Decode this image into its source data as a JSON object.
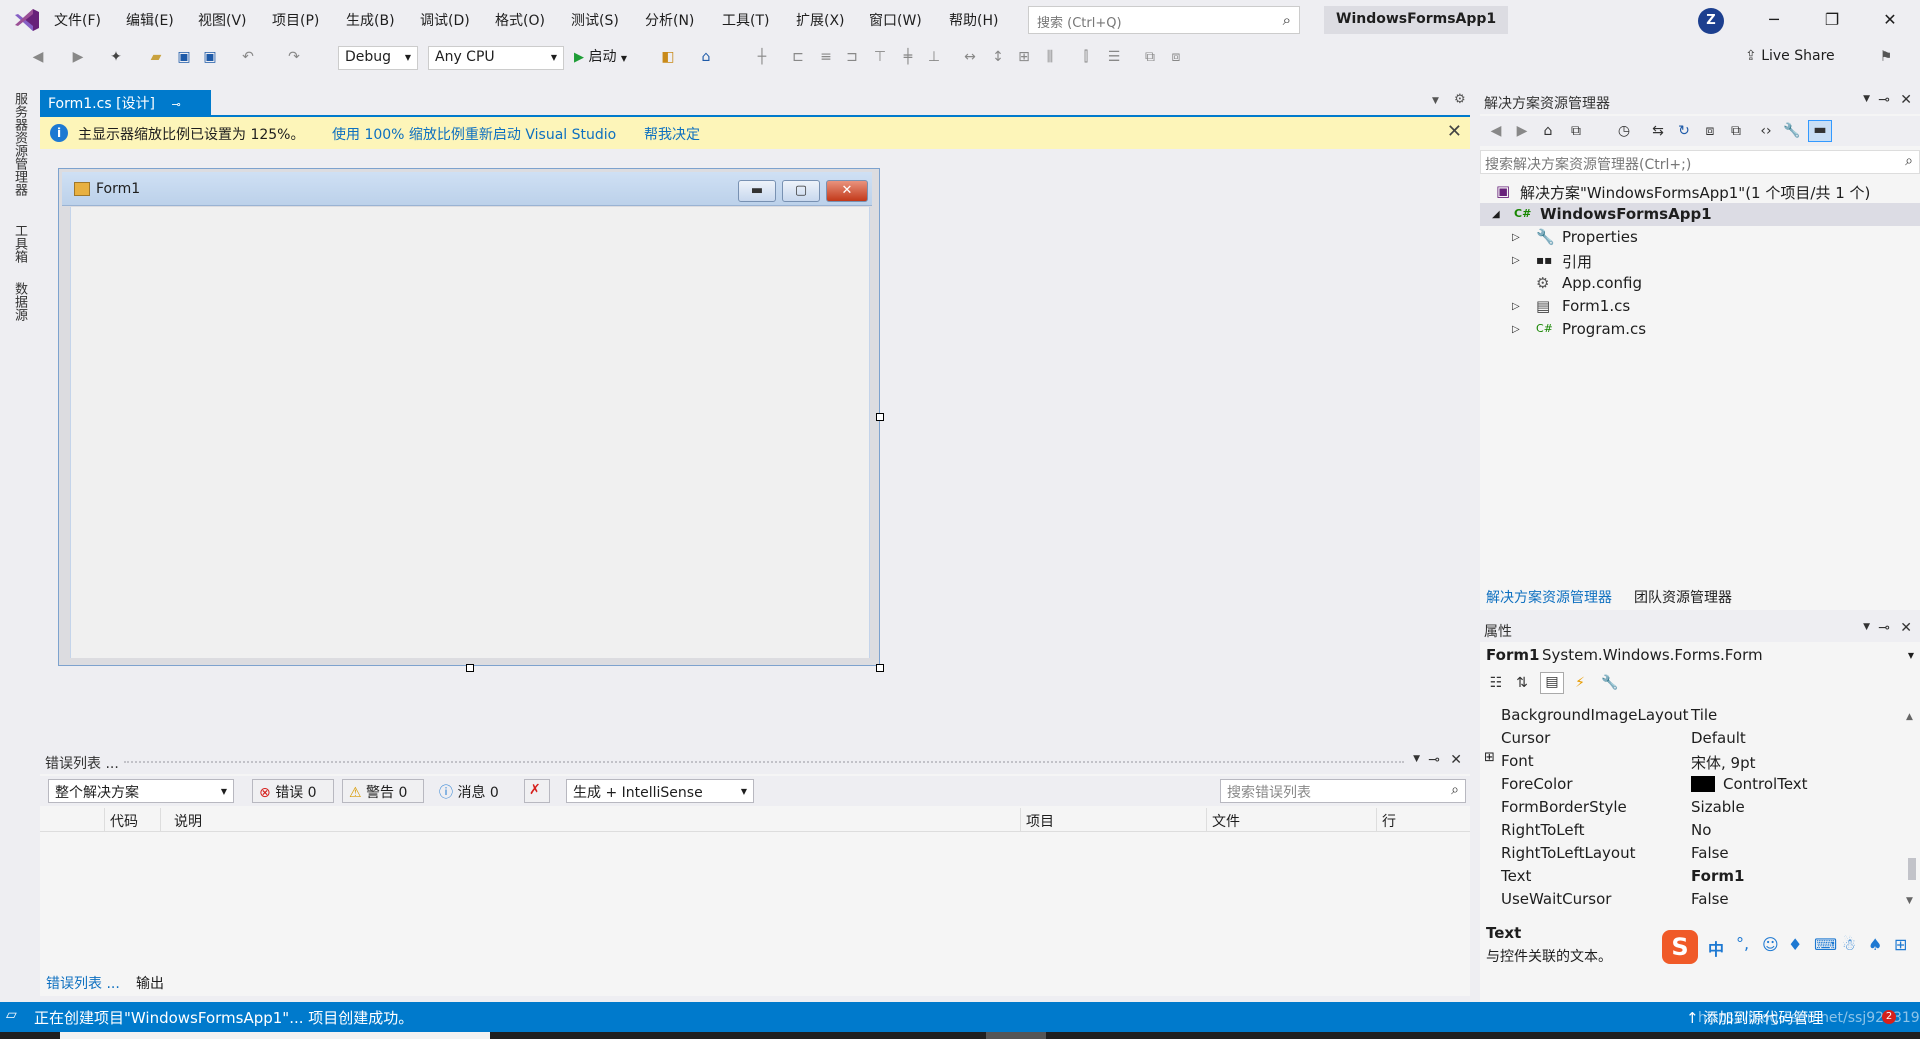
{
  "menu": {
    "items": [
      "文件(F)",
      "编辑(E)",
      "视图(V)",
      "项目(P)",
      "生成(B)",
      "调试(D)",
      "格式(O)",
      "测试(S)",
      "分析(N)",
      "工具(T)",
      "扩展(X)",
      "窗口(W)",
      "帮助(H)"
    ],
    "search_placeholder": "搜索 (Ctrl+Q)",
    "solution_title": "WindowsFormsApp1",
    "avatar": "Z"
  },
  "toolbar": {
    "config": "Debug",
    "platform": "Any CPU",
    "start_label": "启动",
    "live_share": "Live Share"
  },
  "sidebar": {
    "tabs": [
      "服务器资源管理器",
      "工具箱",
      "数据源"
    ]
  },
  "document": {
    "tab_label": "Form1.cs [设计]",
    "info_message": "主显示器缩放比例已设置为 125%。",
    "info_link_restart": "使用 100% 缩放比例重新启动 Visual Studio",
    "info_link_help": "帮我决定",
    "form_title": "Form1"
  },
  "error_list": {
    "title": "错误列表 ...",
    "scope": "整个解决方案",
    "errors": "错误 0",
    "warnings": "警告 0",
    "messages": "消息 0",
    "build_filter": "生成 + IntelliSense",
    "search_placeholder": "搜索错误列表",
    "columns": [
      "代码",
      "说明",
      "项目",
      "文件",
      "行"
    ],
    "bottom_tabs": [
      "错误列表 ...",
      "输出"
    ]
  },
  "solution_explorer": {
    "title": "解决方案资源管理器",
    "search_placeholder": "搜索解决方案资源管理器(Ctrl+;)",
    "items": [
      {
        "label": "解决方案\"WindowsFormsApp1\"(1 个项目/共 1 个)"
      },
      {
        "label": "WindowsFormsApp1"
      },
      {
        "label": "Properties"
      },
      {
        "label": "引用"
      },
      {
        "label": "App.config"
      },
      {
        "label": "Form1.cs"
      },
      {
        "label": "Program.cs"
      }
    ],
    "tabs": [
      "解决方案资源管理器",
      "团队资源管理器"
    ]
  },
  "properties": {
    "title": "属性",
    "object_name": "Form1",
    "object_type": "System.Windows.Forms.Form",
    "rows": [
      {
        "name": "BackgroundImageLayout",
        "value": "Tile"
      },
      {
        "name": "Cursor",
        "value": "Default"
      },
      {
        "name": "Font",
        "value": "宋体, 9pt"
      },
      {
        "name": "ForeColor",
        "value": "ControlText"
      },
      {
        "name": "FormBorderStyle",
        "value": "Sizable"
      },
      {
        "name": "RightToLeft",
        "value": "No"
      },
      {
        "name": "RightToLeftLayout",
        "value": "False"
      },
      {
        "name": "Text",
        "value": "Form1"
      },
      {
        "name": "UseWaitCursor",
        "value": "False"
      }
    ],
    "description_title": "Text",
    "description_text": "与控件关联的文本。"
  },
  "statusbar": {
    "message": "正在创建项目\"WindowsFormsApp1\"... 项目创建成功。",
    "source_control": "添加到源代码管理",
    "watermark": "https://blog.csdn.net/ssj925319"
  },
  "colors": {
    "accent": "#007acc",
    "info_bar": "#fdf5b9",
    "link": "#0e70c0"
  }
}
